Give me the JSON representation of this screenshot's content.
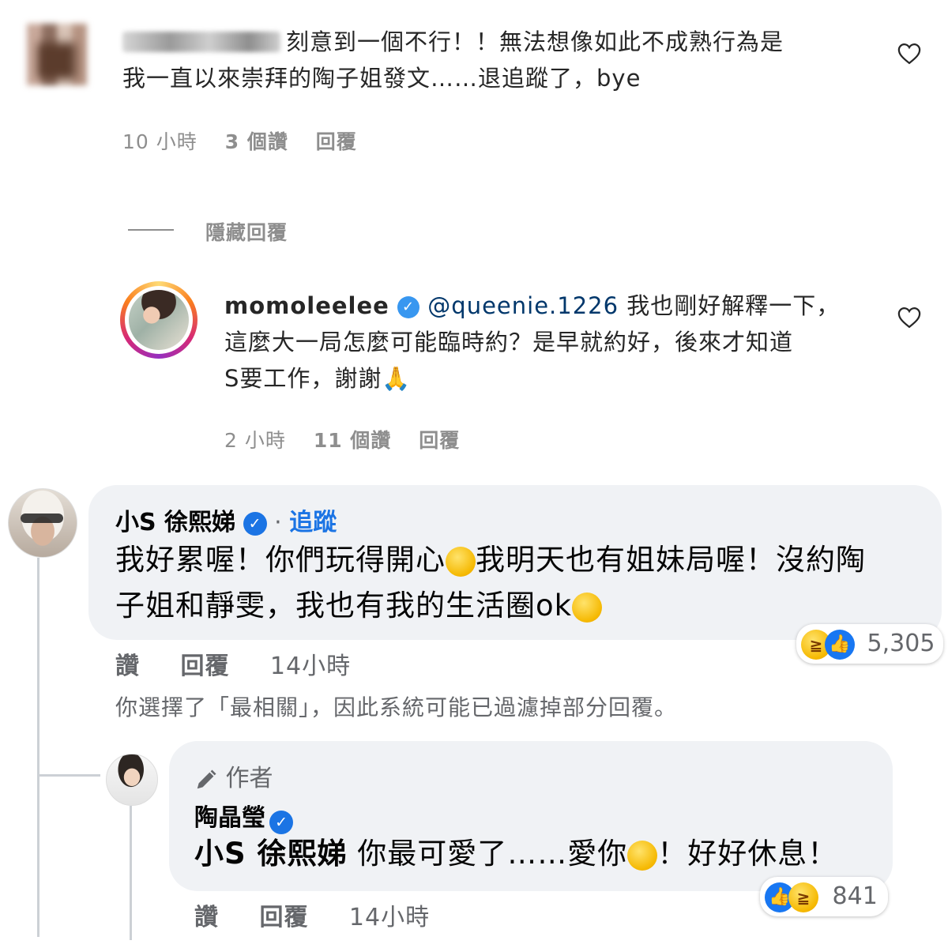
{
  "instagram": {
    "comment1": {
      "text_line1": "刻意到一個不行！！無法想像如此不成熟行為是",
      "text_line2": "我一直以來崇拜的陶子姐發文……退追蹤了，bye",
      "time": "10 小時",
      "likes": "3 個讚",
      "reply": "回覆"
    },
    "hide_replies": "隱藏回覆",
    "reply1": {
      "username": "momoleelee",
      "mention": "@queenie.1226",
      "text_line1": "我也剛好解釋一下，",
      "text_line2": "這麼大一局怎麼可能臨時約？是早就約好，後來才知道",
      "text_line3": "S要工作，謝謝",
      "pray": "🙏",
      "time": "2 小時",
      "likes": "11 個讚",
      "reply": "回覆"
    }
  },
  "facebook": {
    "comment1": {
      "name": "小S 徐熙娣",
      "follow": "追蹤",
      "text_a": "我好累喔！你們玩得開心",
      "text_b": "我明天也有姐妹局喔！沒約陶",
      "text_c": "子姐和靜雯，我也有我的生活圈ok",
      "reaction_count": "5,305",
      "like": "讚",
      "reply": "回覆",
      "time": "14小時"
    },
    "filter_note": "你選擇了「最相關」，因此系統可能已過濾掉部分回覆。",
    "reply1": {
      "author_tag": "作者",
      "name": "陶晶瑩",
      "mention": "小S 徐熙娣",
      "text_a": "你最可愛了……愛你",
      "text_b": "！好好休息！",
      "reaction_count": "841",
      "like": "讚",
      "reply": "回覆",
      "time": "14小時"
    }
  },
  "colors": {
    "ig_link": "#00376b",
    "ig_verified": "#3897f0",
    "fb_blue": "#1b74e4",
    "fb_bubble": "#f0f2f5"
  }
}
